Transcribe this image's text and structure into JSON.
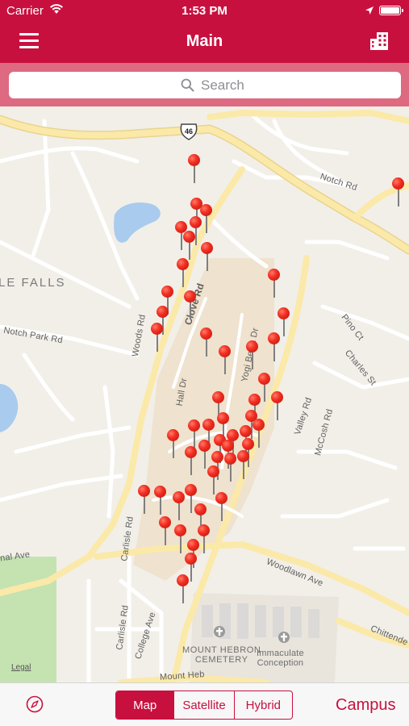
{
  "status_bar": {
    "carrier": "Carrier",
    "time": "1:53 PM"
  },
  "nav": {
    "title": "Main"
  },
  "search": {
    "placeholder": "Search"
  },
  "map": {
    "shield": "46",
    "labels": {
      "notch_rd": "Notch Rd",
      "le_falls": "LE FALLS",
      "notch_park_rd": "Notch Park Rd",
      "woods_rd": "Woods Rd",
      "clove_rd": "Clove Rd",
      "hall_dr": "Hall Dr",
      "yogi_berra_dr": "Yogi Berra Dr",
      "pino_ct": "Pino Ct",
      "charles_st": "Charles St",
      "valley_rd": "Valley Rd",
      "mccosh_rd": "McCosh Rd",
      "carlisle_rd_1": "Carlisle Rd",
      "carlisle_rd_2": "Carlisle Rd",
      "college_ave": "College Ave",
      "woodlawn_ave": "Woodlawn Ave",
      "nal_ave": "nal Ave",
      "chittenden": "Chittende",
      "mount_hebron": "MOUNT HEBRON\nCEMETERY",
      "immaculate": "Immaculate\nConception",
      "mount_hebron_rd": "Mount Heb",
      "legal": "Legal"
    }
  },
  "toolbar": {
    "segments": [
      "Map",
      "Satellite",
      "Hybrid"
    ],
    "selected_segment": "Map",
    "campus": "Campus"
  },
  "colors": {
    "brand": "#c8103f",
    "search_band": "#dd6a80",
    "pin": "#f32f22",
    "map_bg": "#f2efe9"
  },
  "icons": [
    "wifi-icon",
    "location-arrow-icon",
    "battery-icon",
    "hamburger-menu-icon",
    "building-icon",
    "search-icon",
    "compass-icon",
    "map-pin-icon"
  ]
}
